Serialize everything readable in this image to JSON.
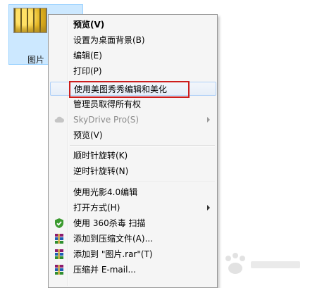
{
  "file": {
    "caption": "图片"
  },
  "menu": {
    "items": [
      {
        "label": "预览(V)"
      },
      {
        "label": "设置为桌面背景(B)"
      },
      {
        "label": "编辑(E)"
      },
      {
        "label": "打印(P)"
      },
      {
        "label": "使用美图秀秀编辑和美化"
      },
      {
        "label": "管理员取得所有权"
      },
      {
        "label": "SkyDrive Pro(S)"
      },
      {
        "label": "预览(V)"
      },
      {
        "label": "顺时针旋转(K)"
      },
      {
        "label": "逆时针旋转(N)"
      },
      {
        "label": "使用光影4.0编辑"
      },
      {
        "label": "打开方式(H)"
      },
      {
        "label": "使用 360杀毒 扫描"
      },
      {
        "label": "添加到压缩文件(A)..."
      },
      {
        "label": "添加到 \"图片.rar\"(T)"
      },
      {
        "label": "压缩并 E-mail..."
      }
    ]
  },
  "colors": {
    "highlight": "#cc1d1d",
    "hover_border": "#aecff7",
    "selection": "#cce8ff"
  },
  "icons": {
    "skydrive": "cloud-icon",
    "antivirus": "shield-icon",
    "archive": "winrar-books-icon"
  }
}
